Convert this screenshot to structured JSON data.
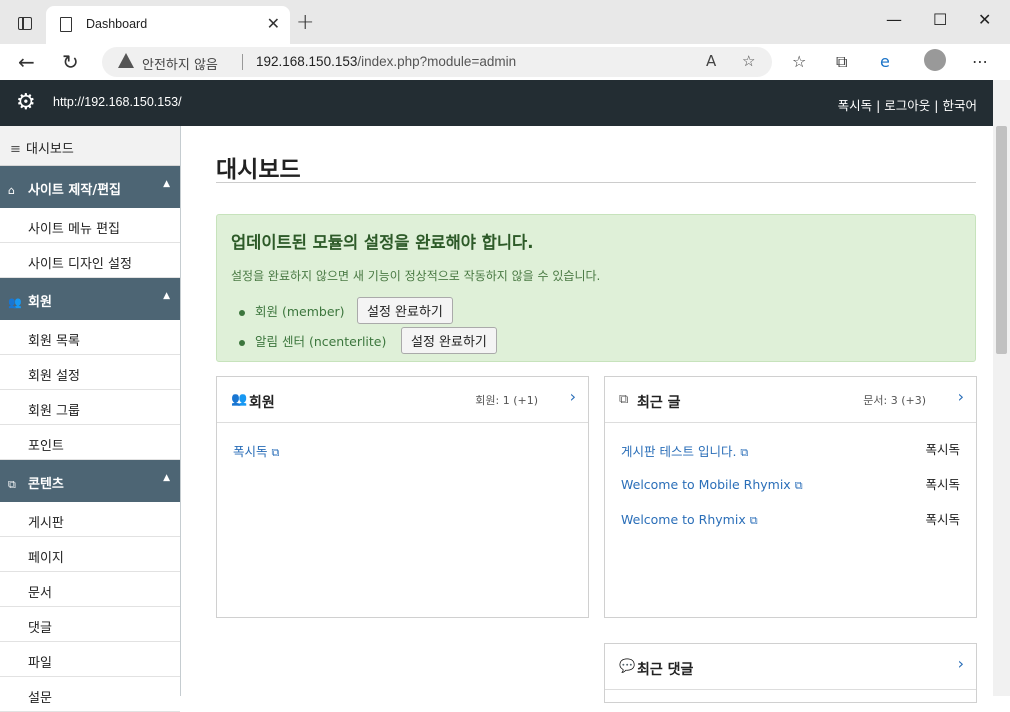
{
  "browser": {
    "tab_title": "Dashboard",
    "security_label": "안전하지 않음",
    "url_host": "192.168.150.153",
    "url_path": "/index.php?module=admin"
  },
  "header": {
    "site_url": "http://192.168.150.153/",
    "user": "폭시독",
    "logout": "로그아웃",
    "language": "한국어",
    "divider": "|"
  },
  "sidebar": {
    "dashboard": "대시보드",
    "groups": [
      {
        "label": "사이트 제작/편집",
        "items": [
          "사이트 메뉴 편집",
          "사이트 디자인 설정"
        ]
      },
      {
        "label": "회원",
        "items": [
          "회원 목록",
          "회원 설정",
          "회원 그룹",
          "포인트"
        ]
      },
      {
        "label": "콘텐츠",
        "items": [
          "게시판",
          "페이지",
          "문서",
          "댓글",
          "파일",
          "설문"
        ]
      }
    ]
  },
  "main": {
    "title": "대시보드",
    "alert": {
      "heading": "업데이트된 모듈의 설정을 완료해야 합니다.",
      "description": "설정을 완료하지 않으면 새 기능이 정상적으로 작동하지 않을 수 있습니다.",
      "modules": [
        {
          "label": "회원 (member)",
          "button": "설정 완료하기"
        },
        {
          "label": "알림 센터 (ncenterlite)",
          "button": "설정 완료하기"
        }
      ]
    },
    "members_panel": {
      "title": "회원",
      "count": "회원: 1 (+1)",
      "items": [
        "폭시독"
      ]
    },
    "docs_panel": {
      "title": "최근 글",
      "count": "문서: 3 (+3)",
      "items": [
        {
          "title": "게시판 테스트 입니다.",
          "author": "폭시독"
        },
        {
          "title": "Welcome to Mobile Rhymix",
          "author": "폭시독"
        },
        {
          "title": "Welcome to Rhymix",
          "author": "폭시독"
        }
      ]
    },
    "comments_panel": {
      "title": "최근 댓글"
    }
  }
}
